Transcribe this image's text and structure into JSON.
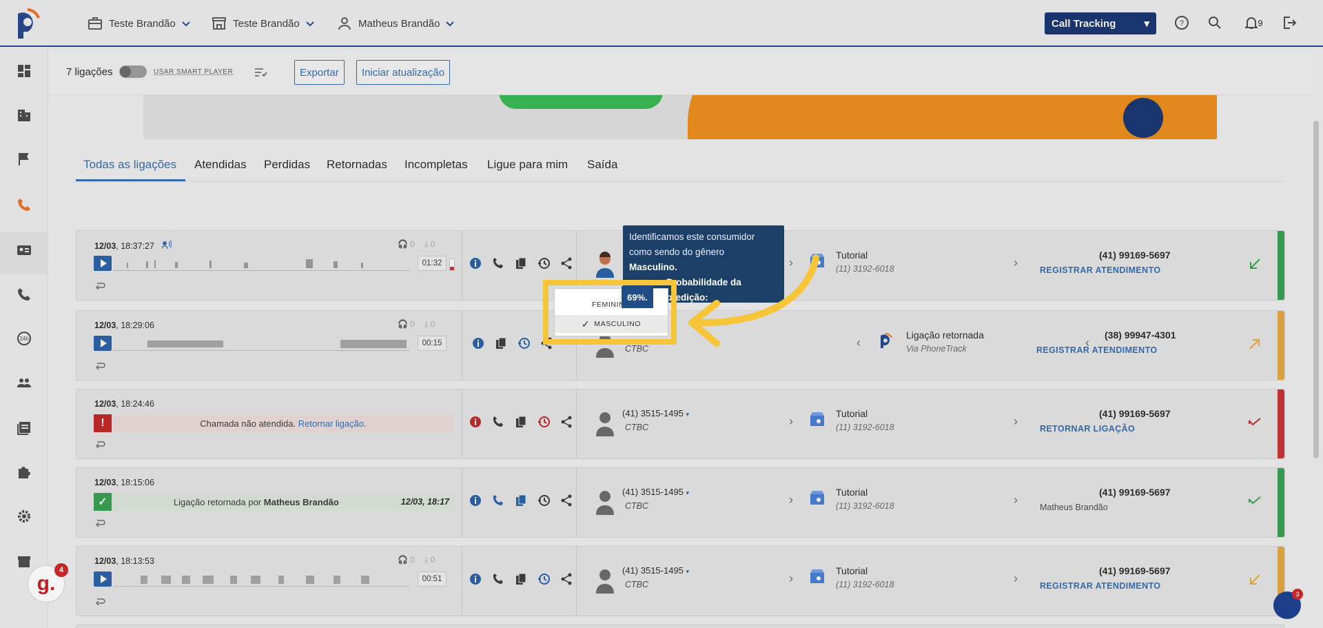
{
  "header": {
    "company1": "Teste Brandão",
    "company2": "Teste Brandão",
    "user": "Matheus Brandão",
    "product_select": "Call Tracking",
    "notifications": "9"
  },
  "toolbar": {
    "count": "7 ligações",
    "smart_player": "USAR SMART PLAYER",
    "export": "Exportar",
    "start_update": "Iniciar atualização"
  },
  "tabs": [
    "Todas as ligações",
    "Atendidas",
    "Perdidas",
    "Retornadas",
    "Incompletas",
    "Ligue para mim",
    "Saída"
  ],
  "tooltip": {
    "line1": "Identificamos este consumidor",
    "line2": "como sendo do gênero",
    "gender": "Masculino.",
    "prob_label": "Probabilidade da predição:",
    "pct": "69%."
  },
  "dropdown": {
    "opt1": "FEMININO",
    "opt2": "MASCULINO"
  },
  "calls": [
    {
      "date": "12/03",
      "time": "18:37:27",
      "listens": "0",
      "downloads": "0",
      "duration": "01:32",
      "origin": "",
      "origin_sub": "",
      "dest": "Tutorial",
      "dest_sub": "(11) 3192-6018",
      "phone": "(41) 99169-5697",
      "action": "REGISTRAR ATENDIMENTO",
      "color": "#2e9d4a"
    },
    {
      "date": "12/03",
      "time": "18:29:06",
      "listens": "0",
      "downloads": "0",
      "duration": "00:15",
      "origin": "",
      "origin_sub": "CTBC",
      "dest": "Ligação retornada",
      "dest_sub": "Via PhoneTrack",
      "phone": "(38) 99947-4301",
      "action": "REGISTRAR ATENDIMENTO",
      "color": "#e9a63a"
    },
    {
      "date": "12/03",
      "time": "18:24:46",
      "missed_text": "Chamada não atendida.",
      "missed_link": "Retornar ligação.",
      "origin": "(41) 3515-1495",
      "origin_sub": "CTBC",
      "dest": "Tutorial",
      "dest_sub": "(11) 3192-6018",
      "phone": "(41) 99169-5697",
      "action": "RETORNAR LIGAÇÃO",
      "color": "#c62828"
    },
    {
      "date": "12/03",
      "time": "18:15:06",
      "returned_text": "Ligação retornada por",
      "returned_by": "Matheus Brandão",
      "returned_at": "12/03, 18:17",
      "origin": "(41) 3515-1495",
      "origin_sub": "CTBC",
      "dest": "Tutorial",
      "dest_sub": "(11) 3192-6018",
      "phone": "(41) 99169-5697",
      "action": "Matheus Brandão",
      "color": "#2e9d4a"
    },
    {
      "date": "12/03",
      "time": "18:13:53",
      "listens": "0",
      "downloads": "0",
      "duration": "00:51",
      "origin": "(41) 3515-1495",
      "origin_sub": "CTBC",
      "dest": "Tutorial",
      "dest_sub": "(11) 3192-6018",
      "phone": "(41) 99169-5697",
      "action": "REGISTRAR ATENDIMENTO",
      "color": "#e9a63a"
    }
  ],
  "badges": {
    "g": "g.",
    "g_count": "4",
    "p_count": "3"
  }
}
